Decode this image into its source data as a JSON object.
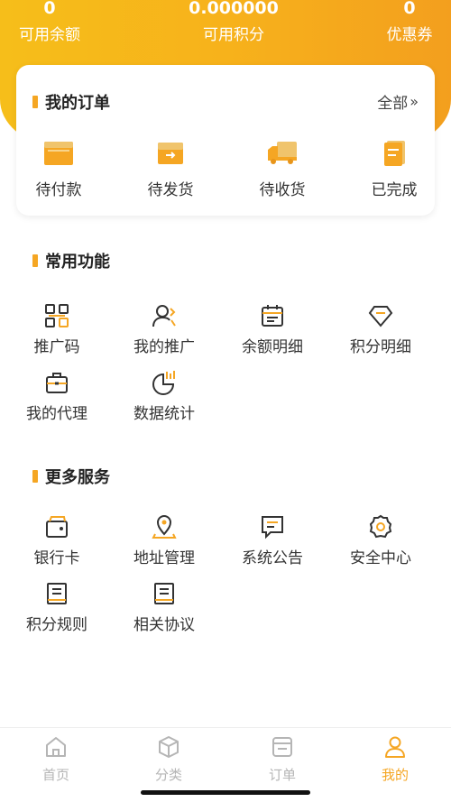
{
  "stats": [
    {
      "value": "0",
      "label": "可用余额"
    },
    {
      "value": "0.000000",
      "label": "可用积分"
    },
    {
      "value": "0",
      "label": "优惠券"
    }
  ],
  "orders": {
    "title": "我的订单",
    "view_all": "全部",
    "items": [
      {
        "label": "待付款",
        "icon": "wallet-icon"
      },
      {
        "label": "待发货",
        "icon": "shipping-box-icon"
      },
      {
        "label": "待收货",
        "icon": "truck-icon"
      },
      {
        "label": "已完成",
        "icon": "completed-note-icon"
      }
    ]
  },
  "common": {
    "title": "常用功能",
    "items": [
      {
        "label": "推广码",
        "icon": "qr-code-icon"
      },
      {
        "label": "我的推广",
        "icon": "user-promo-icon"
      },
      {
        "label": "余额明细",
        "icon": "calendar-detail-icon"
      },
      {
        "label": "积分明细",
        "icon": "diamond-icon"
      },
      {
        "label": "我的代理",
        "icon": "briefcase-icon"
      },
      {
        "label": "数据统计",
        "icon": "pie-chart-icon"
      }
    ]
  },
  "services": {
    "title": "更多服务",
    "items": [
      {
        "label": "银行卡",
        "icon": "bank-card-icon"
      },
      {
        "label": "地址管理",
        "icon": "location-pin-icon"
      },
      {
        "label": "系统公告",
        "icon": "announcement-icon"
      },
      {
        "label": "安全中心",
        "icon": "gear-shield-icon"
      },
      {
        "label": "积分规则",
        "icon": "rules-document-icon"
      },
      {
        "label": "相关协议",
        "icon": "agreement-document-icon"
      }
    ]
  },
  "nav": {
    "items": [
      {
        "label": "首页",
        "icon": "home-icon",
        "active": false
      },
      {
        "label": "分类",
        "icon": "cube-icon",
        "active": false
      },
      {
        "label": "订单",
        "icon": "order-list-icon",
        "active": false
      },
      {
        "label": "我的",
        "icon": "person-icon",
        "active": true
      }
    ]
  },
  "colors": {
    "accent": "#f5a623",
    "header_start": "#f6be1a",
    "header_end": "#f39f1e",
    "nav_inactive": "#b5b5b5"
  }
}
